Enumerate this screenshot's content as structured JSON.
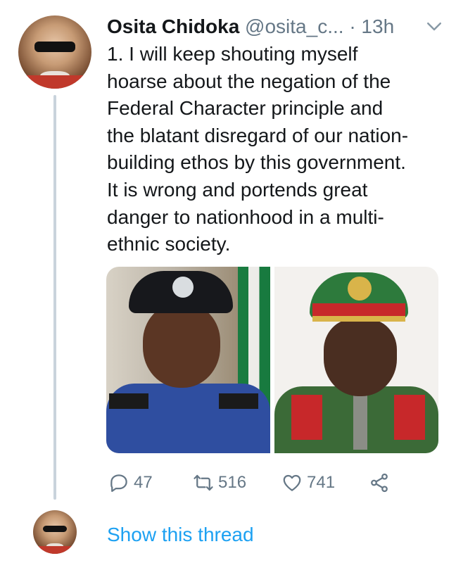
{
  "tweet": {
    "author_name": "Osita Chidoka",
    "handle": "@osita_c...",
    "separator": "·",
    "time": "13h",
    "text": "1. I will keep shouting myself\nhoarse about the negation of the\nFederal Character principle and\nthe blatant disregard of our nation-\nbuilding ethos by this government.\nIt is wrong and portends great\ndanger to nationhood in a multi-\nethnic society.",
    "media": [
      {
        "description_icon": "photo-police-officer"
      },
      {
        "description_icon": "photo-army-officer"
      }
    ]
  },
  "actions": {
    "reply_count": "47",
    "retweet_count": "516",
    "like_count": "741"
  },
  "thread": {
    "show_thread_label": "Show this thread"
  },
  "colors": {
    "link": "#1da1f2",
    "muted": "#657786",
    "thread_line": "#c9d3dc"
  }
}
